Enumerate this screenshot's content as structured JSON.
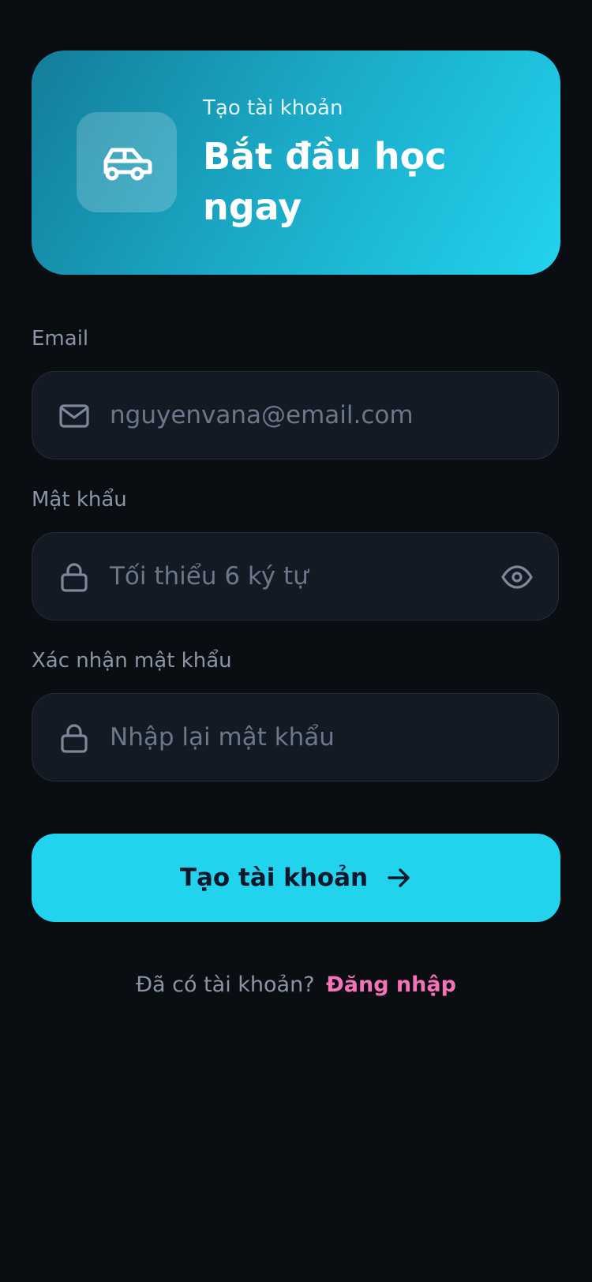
{
  "hero": {
    "eyebrow": "Tạo tài khoản",
    "title": "Bắt đầu học ngay",
    "icon": "car-icon"
  },
  "form": {
    "email": {
      "label": "Email",
      "placeholder": "nguyenvana@email.com",
      "icon": "mail-icon"
    },
    "password": {
      "label": "Mật khẩu",
      "placeholder": "Tối thiểu 6 ký tự",
      "icon": "lock-icon",
      "toggle_icon": "eye-icon"
    },
    "confirm_password": {
      "label": "Xác nhận mật khẩu",
      "placeholder": "Nhập lại mật khẩu",
      "icon": "lock-icon"
    }
  },
  "submit": {
    "label": "Tạo tài khoản",
    "icon": "arrow-right-icon"
  },
  "footer": {
    "question": "Đã có tài khoản?",
    "link": "Đăng nhập"
  },
  "colors": {
    "background": "#0a0d12",
    "accent": "#22d3ee",
    "link": "#f472b6",
    "field_bg": "#131a23",
    "muted_text": "#8a96a8"
  }
}
